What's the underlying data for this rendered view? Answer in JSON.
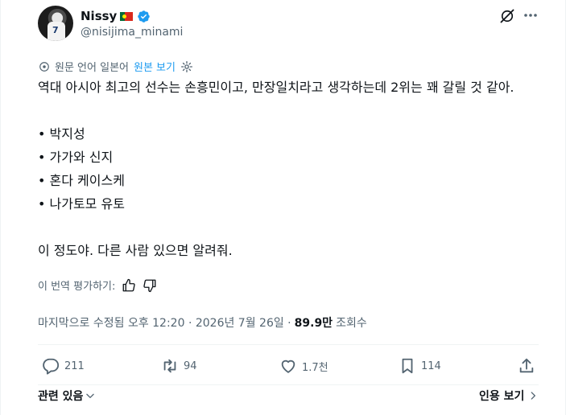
{
  "author": {
    "name": "Nissy",
    "handle": "@nisijima_minami",
    "avatar_number": "7"
  },
  "translation": {
    "notice": "원문 언어 일본어",
    "show_original": "원본 보기"
  },
  "post": {
    "intro": "역대 아시아 최고의 선수는 손흥민이고, 만장일치라고 생각하는데 2위는 꽤 갈릴 것 같아.",
    "list": [
      "• 박지성",
      "• 가가와 신지",
      "• 혼다 케이스케",
      "• 나가토모 유토"
    ],
    "outro": "이 정도야. 다른 사람 있으면 알려줘."
  },
  "rate_translation": "이 번역 평가하기:",
  "meta": {
    "edited_prefix": "마지막으로 수정됨 오후 12:20 · 2026년 7월 26일 ·",
    "views_count": "89.9만",
    "views_label": "조회수"
  },
  "actions": {
    "replies": "211",
    "reposts": "94",
    "likes": "1.7천",
    "bookmarks": "114"
  },
  "footer": {
    "related": "관련 있음",
    "quotes": "인용 보기"
  },
  "colors": {
    "text": "#0f1419",
    "secondary": "#536471",
    "accent": "#1d9bf0"
  },
  "icons": [
    "verified-badge-icon",
    "flag-portugal-icon",
    "grok-icon",
    "more-icon",
    "translate-settings-icon",
    "thumbs-up-icon",
    "thumbs-down-icon",
    "reply-icon",
    "repost-icon",
    "like-icon",
    "bookmark-icon",
    "share-icon",
    "chevron-down-icon",
    "chevron-right-icon"
  ]
}
